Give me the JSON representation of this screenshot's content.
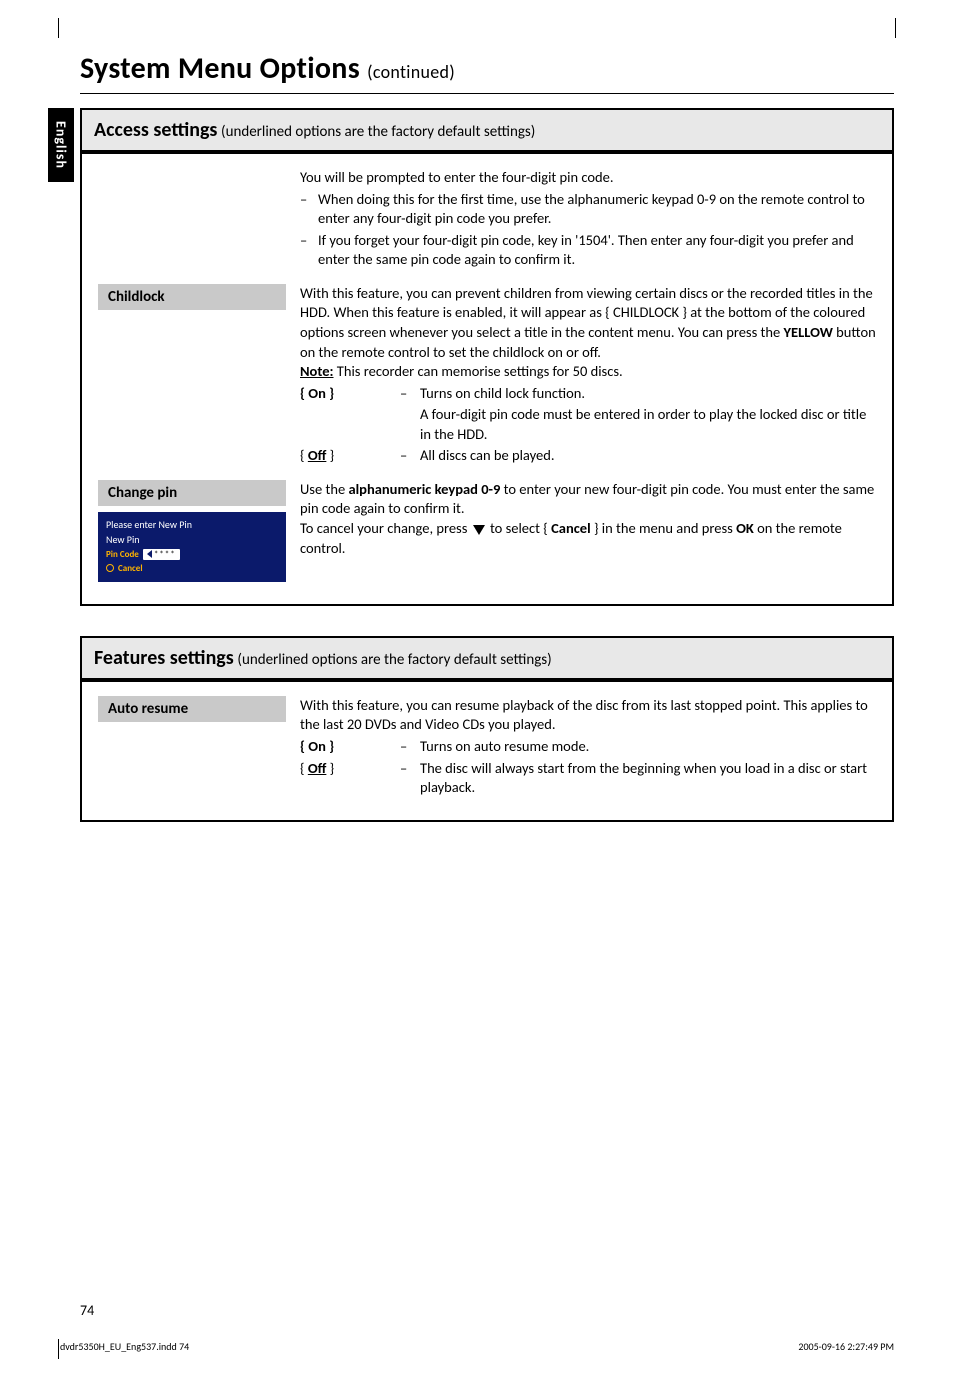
{
  "page": {
    "title_main": "System Menu Options",
    "title_cont": "(continued)",
    "side_tab": "English",
    "page_number": "74",
    "print_left": "dvdr5350H_EU_Eng537.indd   74",
    "print_right": "2005-09-16   2:27:49 PM"
  },
  "panel_access": {
    "header_main": "Access settings",
    "header_sub": "(underlined options are the factory default settings)",
    "intro_text": "You will be prompted to enter the four-digit pin code.",
    "intro_bullets": [
      "When doing this for the first time, use the alphanumeric keypad 0-9 on the remote control to enter any four-digit pin code you prefer.",
      "If you forget your four-digit pin code, key in '1504'. Then enter any four-digit you prefer and enter the same pin code again to confirm it."
    ],
    "childlock": {
      "label": "Childlock",
      "para1": "With this feature, you can prevent children from viewing certain discs or the recorded titles in the HDD.  When this feature is enabled, it will appear as { CHILDLOCK } at the bottom of the coloured options screen whenever you select a title in the content menu.  You can press the ",
      "yellow": "YELLOW",
      "para1_after_yellow": " button on the remote control to set the childlock on or off.",
      "note_label": "Note:",
      "note_text": " This recorder can memorise settings for 50 discs.",
      "on_label": "{ On }",
      "on_line1": "Turns on child lock function.",
      "on_line2": "A four-digit pin code must be entered in order to play the locked disc or title in the HDD.",
      "off_label": "Off",
      "off_line": "All discs can be played."
    },
    "changepin": {
      "label": "Change pin",
      "screenshot": {
        "line1": "Please enter New Pin",
        "line2": "New Pin",
        "pin_label": "Pin Code",
        "pin_value": "****",
        "cancel": "Cancel"
      },
      "para1_a": "Use the ",
      "para1_b": "alphanumeric keypad 0-9",
      "para1_c": " to enter your new four-digit pin code. You must enter the same pin code again to confirm it.",
      "para2_a": "To cancel your change, press ",
      "para2_b": " to select { ",
      "cancel_bold": "Cancel",
      "para2_c": " } in the menu and press ",
      "ok_bold": "OK",
      "para2_d": " on the remote control."
    }
  },
  "panel_features": {
    "header_main": "Features settings",
    "header_sub": "(underlined options are the factory default settings)",
    "autoresume": {
      "label": "Auto resume",
      "para": "With this feature, you can resume playback of the disc from its last stopped point. This applies to the last 20 DVDs and Video CDs you played.",
      "on_label": "{ On }",
      "on_line": "Turns on auto resume mode.",
      "off_label": "Off",
      "off_line": "The disc will always start from the beginning when you load in a disc or start playback."
    }
  }
}
